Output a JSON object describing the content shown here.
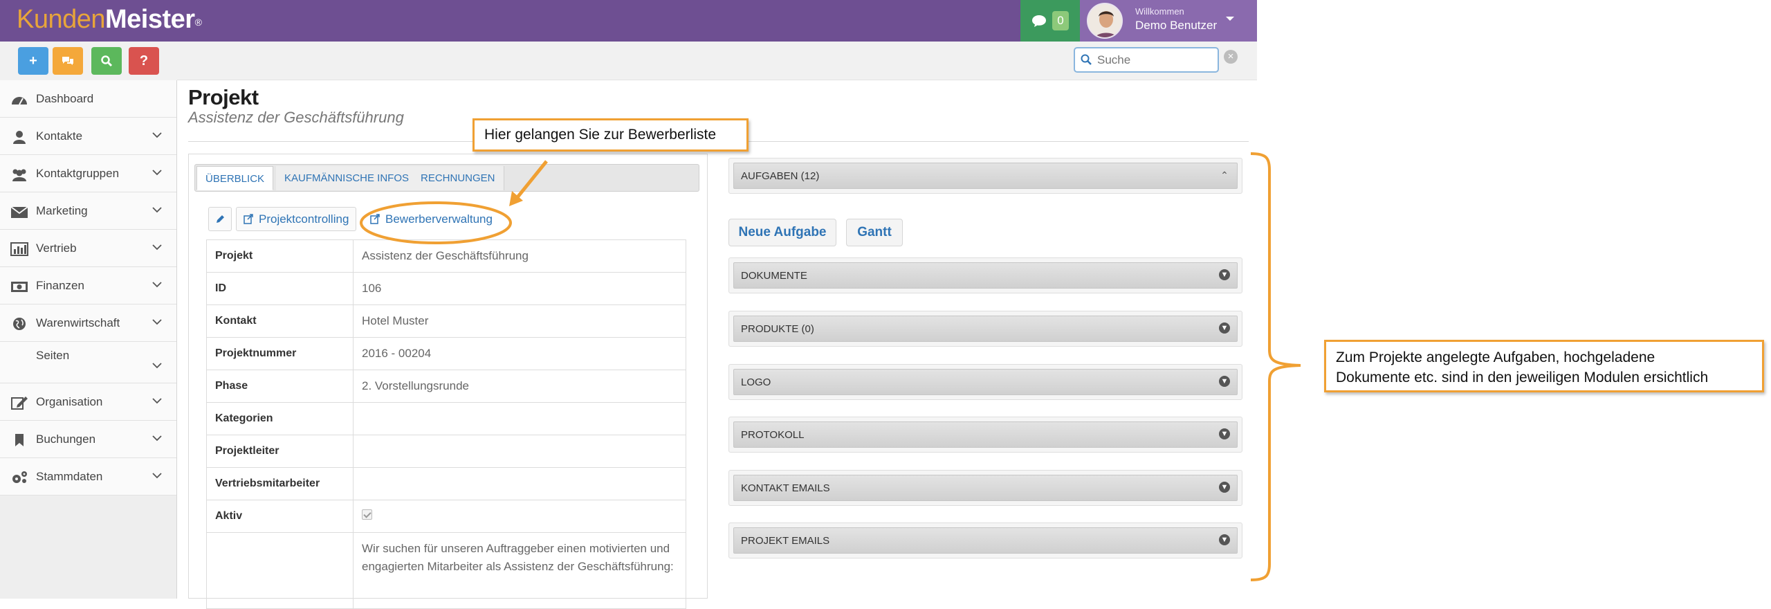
{
  "brand": {
    "part1": "Kunden",
    "part2": "Meister",
    "mark": "®"
  },
  "header": {
    "chat_count": "0",
    "welcome": "Willkommen",
    "user_name": "Demo Benutzer",
    "search_placeholder": "Suche",
    "search_clear": "×"
  },
  "quick_actions": [
    {
      "name": "add",
      "label": "+",
      "color": "#4a9fe0"
    },
    {
      "name": "chat",
      "label": "",
      "color": "#f4a83a"
    },
    {
      "name": "search",
      "label": "",
      "color": "#5cb85c"
    },
    {
      "name": "help",
      "label": "?",
      "color": "#d9534f"
    }
  ],
  "sidebar": {
    "items": [
      {
        "label": "Dashboard",
        "icon": "dashboard-icon",
        "chevron": false
      },
      {
        "label": "Kontakte",
        "icon": "user-icon",
        "chevron": true
      },
      {
        "label": "Kontaktgruppen",
        "icon": "users-icon",
        "chevron": true
      },
      {
        "label": "Marketing",
        "icon": "envelope-icon",
        "chevron": true
      },
      {
        "label": "Vertrieb",
        "icon": "bar-chart-icon",
        "chevron": true
      },
      {
        "label": "Finanzen",
        "icon": "money-icon",
        "chevron": true
      },
      {
        "label": "Warenwirtschaft",
        "icon": "globe-icon",
        "chevron": true
      },
      {
        "label": "Seiten",
        "icon": "",
        "chevron": true
      },
      {
        "label": "Organisation",
        "icon": "edit-icon",
        "chevron": true
      },
      {
        "label": "Buchungen",
        "icon": "bookmark-icon",
        "chevron": true
      },
      {
        "label": "Stammdaten",
        "icon": "cogs-icon",
        "chevron": true
      }
    ]
  },
  "page": {
    "title": "Projekt",
    "subtitle": "Assistenz der Geschäftsführung"
  },
  "tabs": [
    "ÜBERBLICK",
    "KAUFMÄNNISCHE INFOS",
    "RECHNUNGEN"
  ],
  "actions": {
    "controlling": "Projektcontrolling",
    "bewerber": "Bewerberverwaltung"
  },
  "details": [
    {
      "key": "Projekt",
      "value": "Assistenz der Geschäftsführung"
    },
    {
      "key": "ID",
      "value": "106"
    },
    {
      "key": "Kontakt",
      "value": "Hotel Muster"
    },
    {
      "key": "Projektnummer",
      "value": "2016 - 00204"
    },
    {
      "key": "Phase",
      "value": "2. Vorstellungsrunde"
    },
    {
      "key": "Kategorien",
      "value": ""
    },
    {
      "key": "Projektleiter",
      "value": ""
    },
    {
      "key": "Vertriebsmitarbeiter",
      "value": ""
    },
    {
      "key": "Aktiv",
      "value": ""
    },
    {
      "key": "",
      "value": "Wir suchen für unseren Auftraggeber einen motivierten und engagierten Mitarbeiter als Assistenz der Geschäftsführung:"
    }
  ],
  "aktiv_checked": true,
  "right": {
    "aufgaben": "AUFGABEN (12)",
    "neue_aufgabe": "Neue Aufgabe",
    "gantt": "Gantt",
    "sections": [
      "DOKUMENTE",
      "PRODUKTE (0)",
      "LOGO",
      "PROTOKOLL",
      "KONTAKT EMAILS",
      "PROJEKT EMAILS"
    ]
  },
  "annotations": {
    "top": "Hier gelangen Sie zur Bewerberliste",
    "right_line1": "Zum Projekte angelegte Aufgaben, hochgeladene",
    "right_line2": "Dokumente etc. sind in den jeweiligen Modulen ersichtlich"
  },
  "colors": {
    "accent": "#f0a033",
    "brand_bar": "#6e4f92",
    "link": "#2f74b5"
  }
}
